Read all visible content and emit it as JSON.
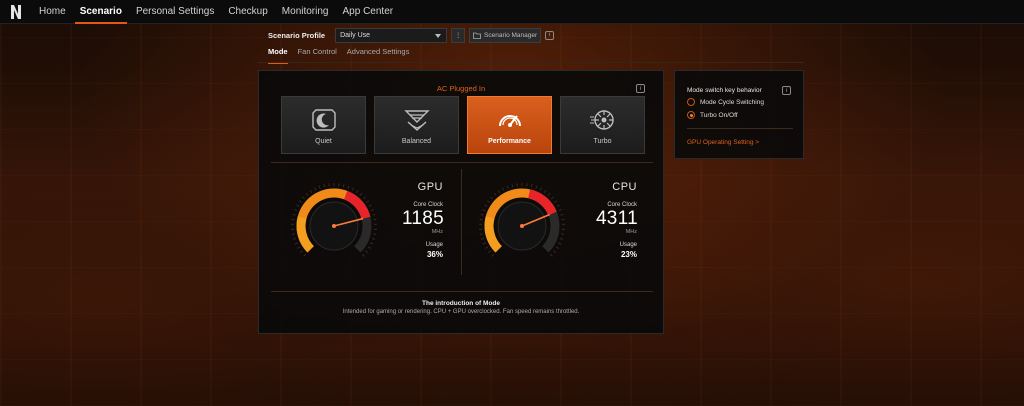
{
  "nav": {
    "items": [
      {
        "label": "Home"
      },
      {
        "label": "Scenario"
      },
      {
        "label": "Personal Settings"
      },
      {
        "label": "Checkup"
      },
      {
        "label": "Monitoring"
      },
      {
        "label": "App Center"
      }
    ],
    "active": "Scenario"
  },
  "profile": {
    "label": "Scenario Profile",
    "selected": "Daily Use",
    "manager_button": "Scenario Manager"
  },
  "subtabs": [
    "Mode",
    "Fan Control",
    "Advanced Settings"
  ],
  "mode_panel": {
    "power_status": "AC Plugged In",
    "modes": [
      {
        "label": "Quiet",
        "icon": "moon-icon"
      },
      {
        "label": "Balanced",
        "icon": "chevrons-icon"
      },
      {
        "label": "Performance",
        "icon": "speedometer-icon"
      },
      {
        "label": "Turbo",
        "icon": "turbine-icon"
      }
    ],
    "active_mode": "Performance"
  },
  "gpu": {
    "title": "GPU",
    "clock_label": "Core Clock",
    "clock_value": "1185",
    "clock_unit": "MHz",
    "usage_label": "Usage",
    "usage_value": "36%",
    "usage_fraction": 0.36
  },
  "cpu": {
    "title": "CPU",
    "clock_label": "Core Clock",
    "clock_value": "4311",
    "clock_unit": "MHz",
    "usage_label": "Usage",
    "usage_value": "23%",
    "usage_fraction": 0.23
  },
  "intro": {
    "title": "The introduction of Mode",
    "text": "Intended for gaming or rendering. CPU + GPU overclocked. Fan speed remains throttled."
  },
  "switch_panel": {
    "title": "Mode switch key behavior",
    "options": [
      {
        "label": "Mode Cycle Switching",
        "checked": false
      },
      {
        "label": "Turbo On/Off",
        "checked": true
      }
    ],
    "link": "GPU Operating Setting >"
  },
  "colors": {
    "accent": "#e05a16",
    "gauge_red": "#e8242a",
    "gauge_orange": "#f08a18"
  }
}
